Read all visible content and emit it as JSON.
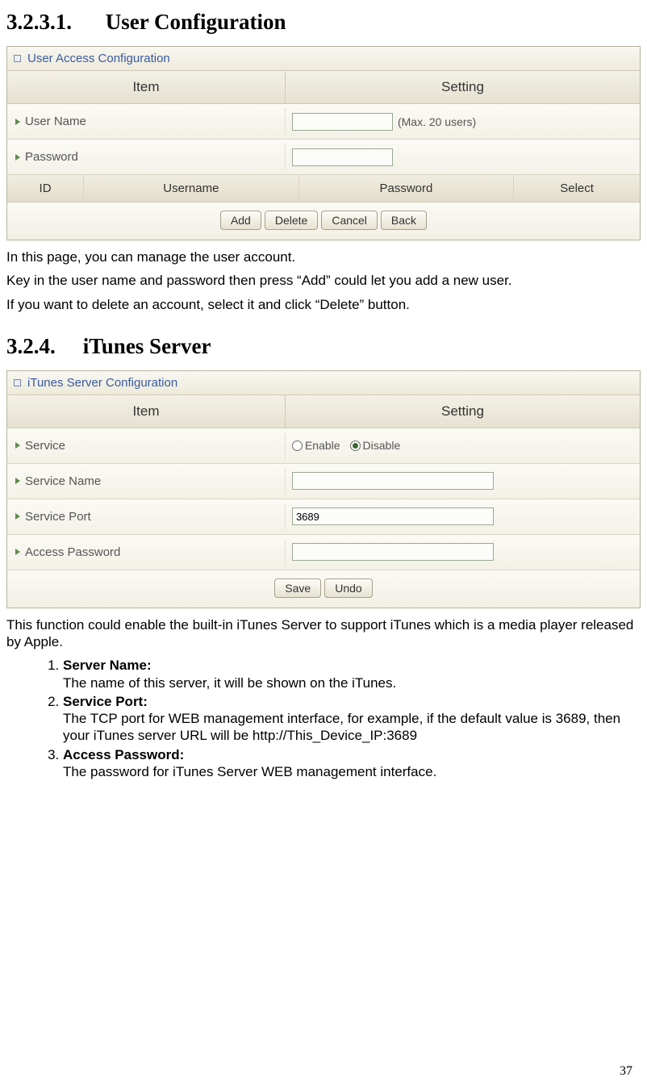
{
  "section1": {
    "number": "3.2.3.1.",
    "title": "User Configuration"
  },
  "panel1": {
    "title": "User Access Configuration",
    "headers": {
      "item": "Item",
      "setting": "Setting"
    },
    "rows": {
      "username": {
        "label": "User Name",
        "hint": "(Max. 20 users)",
        "value": ""
      },
      "password": {
        "label": "Password",
        "value": ""
      }
    },
    "subheaders": {
      "id": "ID",
      "username": "Username",
      "password": "Password",
      "select": "Select"
    },
    "buttons": {
      "add": "Add",
      "delete": "Delete",
      "cancel": "Cancel",
      "back": "Back"
    }
  },
  "text1": {
    "p1": "In this page, you can manage the user account.",
    "p2": "Key in the user name and password then press “Add” could let you add a new user.",
    "p3": "If you want to delete an account, select it and click “Delete” button."
  },
  "section2": {
    "number": "3.2.4.",
    "title": "iTunes Server"
  },
  "panel2": {
    "title": "iTunes Server Configuration",
    "headers": {
      "item": "Item",
      "setting": "Setting"
    },
    "rows": {
      "service": {
        "label": "Service",
        "enable": "Enable",
        "disable": "Disable",
        "selected": "disable"
      },
      "serviceName": {
        "label": "Service Name",
        "value": ""
      },
      "servicePort": {
        "label": "Service Port",
        "value": "3689"
      },
      "accessPassword": {
        "label": "Access Password",
        "value": ""
      }
    },
    "buttons": {
      "save": "Save",
      "undo": "Undo"
    }
  },
  "text2": {
    "intro": "This function could enable the built-in iTunes Server to support iTunes which is a media player released by Apple.",
    "items": [
      {
        "label": "Server Name:",
        "body": "The name of this server, it will be shown on the iTunes."
      },
      {
        "label": "Service Port:",
        "body": "The TCP port for WEB management interface, for example, if the default value is 3689, then your iTunes server URL will be http://This_Device_IP:3689"
      },
      {
        "label": "Access Password:",
        "body": "The password for iTunes Server WEB management interface."
      }
    ]
  },
  "pagenum": "37"
}
